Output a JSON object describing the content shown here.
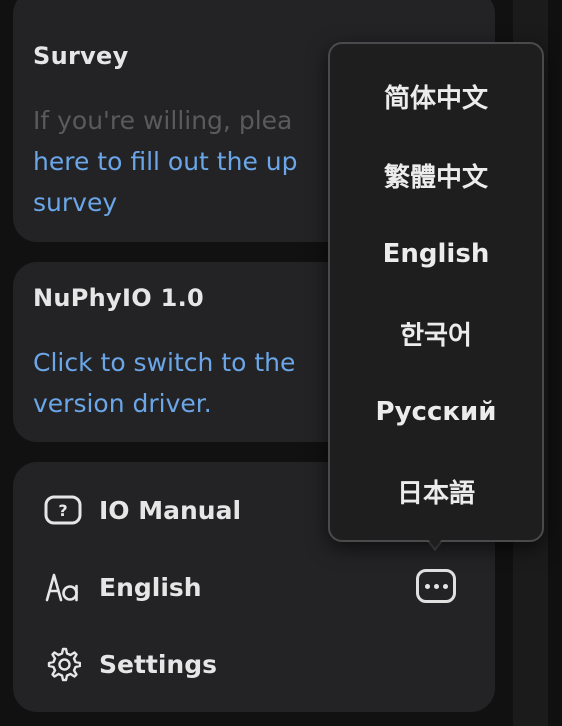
{
  "survey": {
    "title": "Survey",
    "line1": "If you're willing, plea",
    "line2": "here to fill out the up",
    "line3": "survey"
  },
  "nuphy": {
    "title": "NuPhyIO 1.0",
    "line1": "Click to switch to the",
    "line2": "version driver."
  },
  "menu": {
    "manual": "IO Manual",
    "language": "English",
    "settings": "Settings"
  },
  "language_popup": {
    "options": [
      "简体中文",
      "繁體中文",
      "English",
      "한국어",
      "Русский",
      "日本語"
    ]
  },
  "colors": {
    "card_bg": "#232325",
    "link": "#6aa6e8",
    "text": "#e6e6e6"
  }
}
